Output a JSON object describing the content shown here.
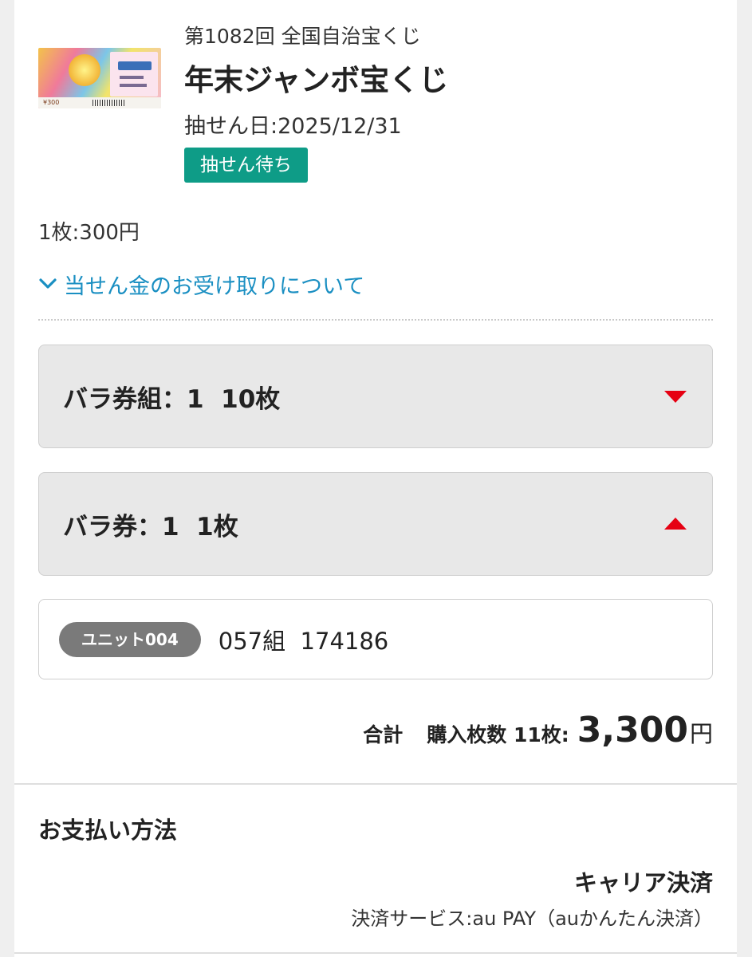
{
  "ticket": {
    "round_title": "第1082回 全国自治宝くじ",
    "name": "年末ジャンボ宝くじ",
    "draw_date": "抽せん日:2025/12/31",
    "status": "抽せん待ち",
    "unit_price": "1枚:300円",
    "image_price_mark": "¥300"
  },
  "receipt_link": {
    "label": "当せん金のお受け取りについて",
    "icon": "chevron-down-icon"
  },
  "groups": [
    {
      "label": "バラ券組：1  10枚",
      "icon": "triangle-down-icon",
      "expanded": false
    },
    {
      "label": "バラ券：1  1枚",
      "icon": "triangle-up-icon",
      "expanded": true
    }
  ],
  "ticket_entry": {
    "unit": "ユニット004",
    "number": "057組  174186"
  },
  "total": {
    "label": "合計",
    "count": "購入枚数 11枚:",
    "amount": "3,300",
    "currency": "円"
  },
  "payment": {
    "heading": "お支払い方法",
    "method": "キャリア決済",
    "service": "決済サービス:au PAY（auかんたん決済）"
  },
  "colors": {
    "accent_green": "#0e9c87",
    "link_blue": "#1a8fc2",
    "toggle_red": "#e60012",
    "pill_gray": "#7a7a7a"
  }
}
